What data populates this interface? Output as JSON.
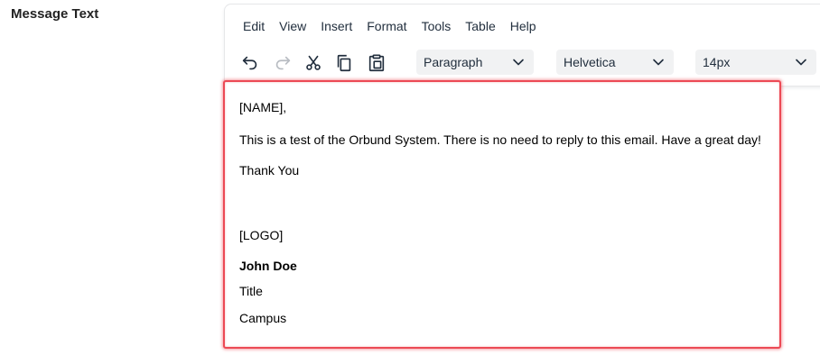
{
  "field_label": "Message Text",
  "menubar": {
    "items": [
      "Edit",
      "View",
      "Insert",
      "Format",
      "Tools",
      "Table",
      "Help"
    ]
  },
  "toolbar": {
    "icons": [
      "undo-icon",
      "redo-icon",
      "cut-icon",
      "copy-icon",
      "paste-icon"
    ],
    "block_format": "Paragraph",
    "font_family": "Helvetica",
    "font_size": "14px"
  },
  "content": {
    "greeting": "[NAME],",
    "body": "This is a test of the Orbund System. There is no need to reply to this email. Have a great day!",
    "closing": "Thank You",
    "logo": "[LOGO]",
    "signature_name": "John Doe",
    "signature_title": "Title",
    "signature_campus": "Campus"
  },
  "colors": {
    "focus_border": "#ec4a55",
    "toolbar_select_bg": "#f1f2f3",
    "text": "#222f3e"
  }
}
